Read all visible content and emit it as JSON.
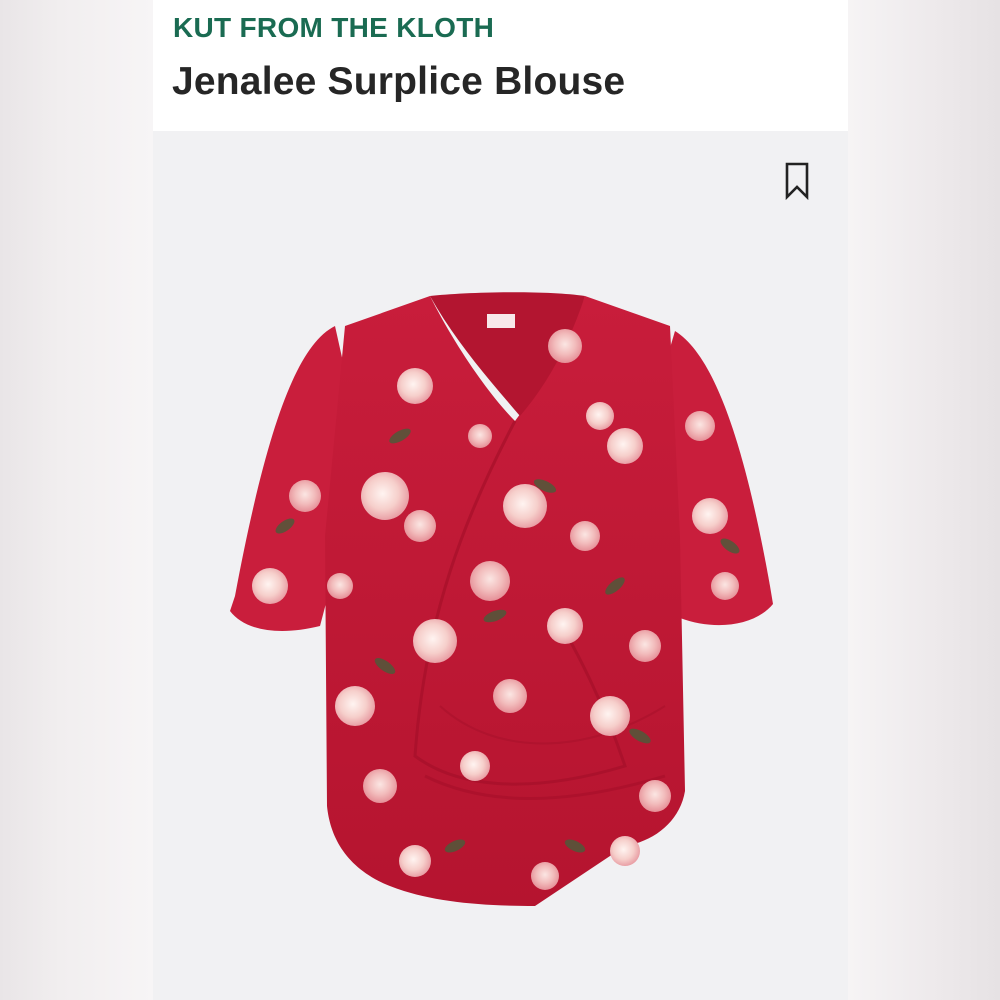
{
  "product": {
    "brand": "KUT FROM THE KLOTH",
    "name": "Jenalee Surplice Blouse",
    "image_icon": "floral-surplice-blouse-image"
  },
  "actions": {
    "bookmark_icon": "bookmark-icon"
  },
  "colors": {
    "brand_green": "#1a6b52",
    "title_text": "#262626",
    "blouse_red": "#d0203e",
    "flower_pink": "#f3c2c1"
  }
}
